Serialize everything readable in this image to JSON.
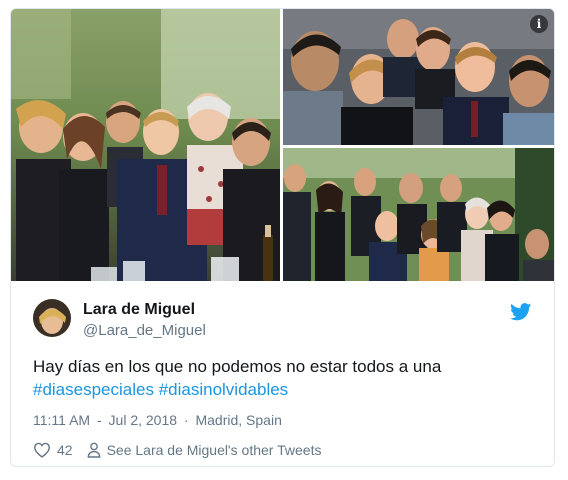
{
  "tweet": {
    "display_name": "Lara de Miguel",
    "handle": "@Lara_de_Miguel",
    "text": "Hay días en los que no podemos no estar todos a una",
    "hashtags": [
      "#diasespeciales",
      "#diasinolvidables"
    ],
    "time": "11:11 AM",
    "date": "Jul 2, 2018",
    "location": "Madrid, Spain",
    "likes": "42",
    "see_more_label": "See Lara de Miguel's other Tweets",
    "info_badge": "i"
  },
  "separator": "-",
  "location_separator": "·",
  "colors": {
    "link": "#1b95e0",
    "muted": "#657786",
    "twitter_blue": "#1da1f2"
  },
  "icons": {
    "logo": "twitter-bird-icon",
    "like": "heart-icon",
    "profile": "person-icon",
    "info": "info-icon"
  }
}
